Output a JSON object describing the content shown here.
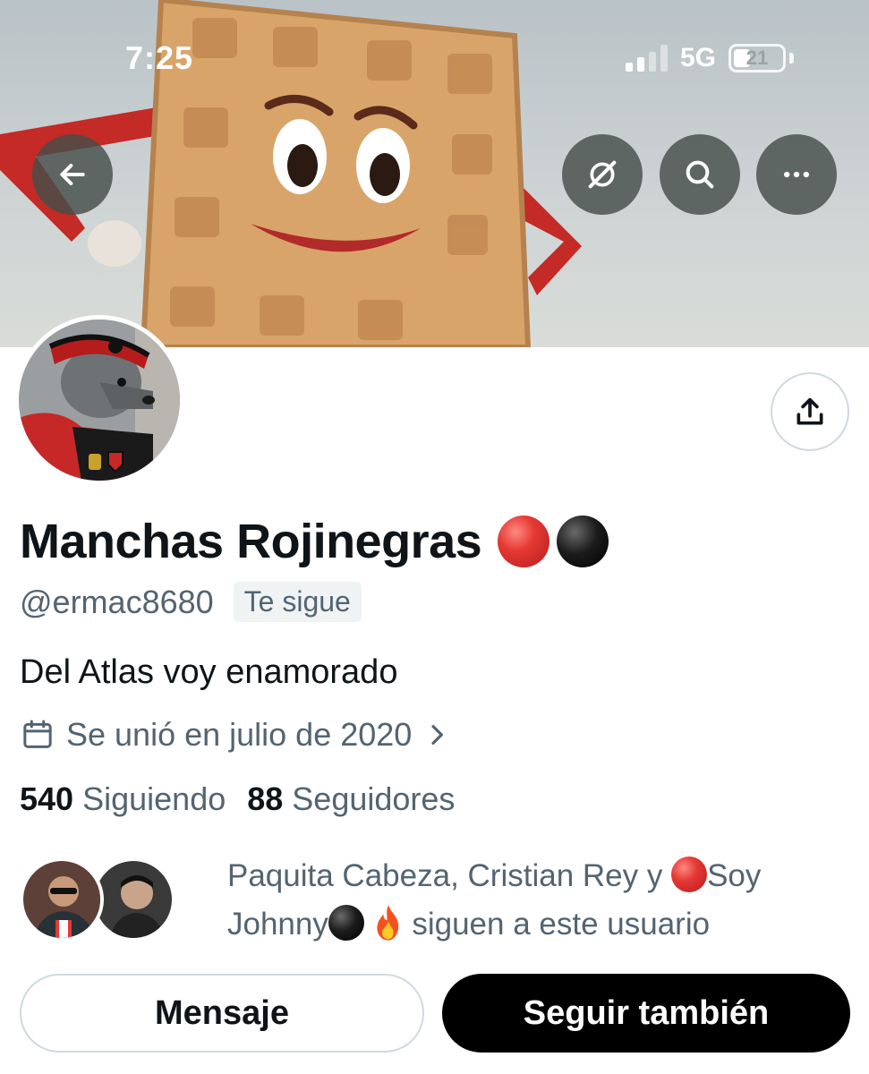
{
  "status_bar": {
    "time": "7:25",
    "network": "5G",
    "battery": "21"
  },
  "header": {
    "back_icon": "arrow-left-icon",
    "action_icons": [
      "grok-icon",
      "search-icon",
      "more-icon"
    ]
  },
  "profile": {
    "display_name": "Manchas Rojinegras",
    "name_emojis": [
      "red-circle",
      "black-circle"
    ],
    "handle": "@ermac8680",
    "follows_you": "Te sigue",
    "bio": "Del Atlas voy enamorado",
    "joined": "Se unió en julio de 2020",
    "following_count": "540",
    "following_label": "Siguiendo",
    "followers_count": "88",
    "followers_label": "Seguidores"
  },
  "known_followers": {
    "part1": "Paquita Cabeza, Cristian Rey y ",
    "part2": "Soy",
    "part3": "Johnny",
    "part4": " siguen a este usuario"
  },
  "actions": {
    "message_label": "Mensaje",
    "follow_label": "Seguir también"
  },
  "colors": {
    "primary_text": "#0f1419",
    "secondary_text": "#536471",
    "border": "#cfd9de",
    "follow_button": "#000000"
  }
}
